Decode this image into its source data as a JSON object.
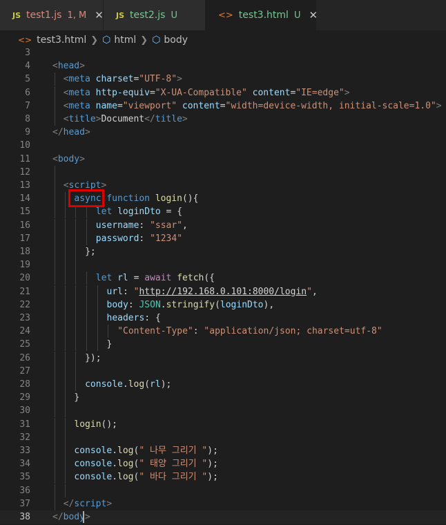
{
  "tabs": [
    {
      "icon": "JS",
      "name": "test1.js",
      "status": "1, M",
      "close": "✕"
    },
    {
      "icon": "JS",
      "name": "test2.js",
      "status": "U",
      "close": ""
    },
    {
      "icon": "<>",
      "name": "test3.html",
      "status": "U",
      "close": "✕"
    }
  ],
  "breadcrumb": {
    "file": "test3.html",
    "items": [
      "html",
      "body"
    ]
  },
  "colors": {
    "modified": "#e0867a",
    "untracked": "#73c991",
    "annotation": "#e00000"
  },
  "editor": {
    "lines": [
      {
        "n": "3",
        "indent": 0,
        "tokens": []
      },
      {
        "n": "4",
        "indent": 0,
        "tokens": [
          [
            "br",
            "<"
          ],
          [
            "tag",
            "head"
          ],
          [
            "br",
            ">"
          ]
        ]
      },
      {
        "n": "5",
        "indent": 1,
        "tokens": [
          [
            "br",
            "<"
          ],
          [
            "tag",
            "meta"
          ],
          [
            "txt",
            " "
          ],
          [
            "attr",
            "charset"
          ],
          [
            "txt",
            "="
          ],
          [
            "str",
            "\"UTF-8\""
          ],
          [
            "br",
            ">"
          ]
        ]
      },
      {
        "n": "6",
        "indent": 1,
        "tokens": [
          [
            "br",
            "<"
          ],
          [
            "tag",
            "meta"
          ],
          [
            "txt",
            " "
          ],
          [
            "attr",
            "http-equiv"
          ],
          [
            "txt",
            "="
          ],
          [
            "str",
            "\"X-UA-Compatible\""
          ],
          [
            "txt",
            " "
          ],
          [
            "attr",
            "content"
          ],
          [
            "txt",
            "="
          ],
          [
            "str",
            "\"IE=edge\""
          ],
          [
            "br",
            ">"
          ]
        ]
      },
      {
        "n": "7",
        "indent": 1,
        "tokens": [
          [
            "br",
            "<"
          ],
          [
            "tag",
            "meta"
          ],
          [
            "txt",
            " "
          ],
          [
            "attr",
            "name"
          ],
          [
            "txt",
            "="
          ],
          [
            "str",
            "\"viewport\""
          ],
          [
            "txt",
            " "
          ],
          [
            "attr",
            "content"
          ],
          [
            "txt",
            "="
          ],
          [
            "str",
            "\"width=device-width, initial-scale=1.0\""
          ],
          [
            "br",
            ">"
          ]
        ]
      },
      {
        "n": "8",
        "indent": 1,
        "tokens": [
          [
            "br",
            "<"
          ],
          [
            "tag",
            "title"
          ],
          [
            "br",
            ">"
          ],
          [
            "txt",
            "Document"
          ],
          [
            "br",
            "</"
          ],
          [
            "tag",
            "title"
          ],
          [
            "br",
            ">"
          ]
        ]
      },
      {
        "n": "9",
        "indent": 0,
        "tokens": [
          [
            "br",
            "</"
          ],
          [
            "tag",
            "head"
          ],
          [
            "br",
            ">"
          ]
        ]
      },
      {
        "n": "10",
        "indent": 0,
        "tokens": []
      },
      {
        "n": "11",
        "indent": 0,
        "tokens": [
          [
            "br",
            "<"
          ],
          [
            "tag",
            "body"
          ],
          [
            "br",
            ">"
          ]
        ]
      },
      {
        "n": "12",
        "indent": 1,
        "tokens": []
      },
      {
        "n": "13",
        "indent": 1,
        "tokens": [
          [
            "br",
            "<"
          ],
          [
            "tag",
            "script"
          ],
          [
            "br",
            ">"
          ]
        ]
      },
      {
        "n": "14",
        "indent": 2,
        "tokens": [
          [
            "kw",
            "async"
          ],
          [
            "txt",
            " "
          ],
          [
            "kw",
            "function"
          ],
          [
            "txt",
            " "
          ],
          [
            "fn",
            "login"
          ],
          [
            "txt",
            "(){"
          ]
        ]
      },
      {
        "n": "15",
        "indent": 4,
        "tokens": [
          [
            "kw",
            "let"
          ],
          [
            "txt",
            " "
          ],
          [
            "var",
            "loginDto"
          ],
          [
            "txt",
            " = {"
          ]
        ]
      },
      {
        "n": "16",
        "indent": 4,
        "tokens": [
          [
            "var",
            "username"
          ],
          [
            "txt",
            ": "
          ],
          [
            "str",
            "\"ssar\""
          ],
          [
            "txt",
            ","
          ]
        ]
      },
      {
        "n": "17",
        "indent": 4,
        "tokens": [
          [
            "var",
            "password"
          ],
          [
            "txt",
            ": "
          ],
          [
            "str",
            "\"1234\""
          ]
        ]
      },
      {
        "n": "18",
        "indent": 3,
        "tokens": [
          [
            "txt",
            "};"
          ]
        ]
      },
      {
        "n": "19",
        "indent": 3,
        "tokens": []
      },
      {
        "n": "20",
        "indent": 4,
        "tokens": [
          [
            "kw",
            "let"
          ],
          [
            "txt",
            " "
          ],
          [
            "var",
            "rl"
          ],
          [
            "txt",
            " = "
          ],
          [
            "ctl",
            "await"
          ],
          [
            "txt",
            " "
          ],
          [
            "fn",
            "fetch"
          ],
          [
            "txt",
            "({"
          ]
        ]
      },
      {
        "n": "21",
        "indent": 5,
        "tokens": [
          [
            "var",
            "url"
          ],
          [
            "txt",
            ": "
          ],
          [
            "str",
            "\""
          ],
          [
            "url",
            "http://192.168.0.101:8000/login"
          ],
          [
            "str",
            "\""
          ],
          [
            "txt",
            ","
          ]
        ]
      },
      {
        "n": "22",
        "indent": 5,
        "tokens": [
          [
            "var",
            "body"
          ],
          [
            "txt",
            ": "
          ],
          [
            "cls",
            "JSON"
          ],
          [
            "txt",
            "."
          ],
          [
            "fn",
            "stringify"
          ],
          [
            "txt",
            "("
          ],
          [
            "var",
            "loginDto"
          ],
          [
            "txt",
            "),"
          ]
        ]
      },
      {
        "n": "23",
        "indent": 5,
        "tokens": [
          [
            "var",
            "headers"
          ],
          [
            "txt",
            ": {"
          ]
        ]
      },
      {
        "n": "24",
        "indent": 6,
        "tokens": [
          [
            "str",
            "\"Content-Type\""
          ],
          [
            "txt",
            ": "
          ],
          [
            "str",
            "\"application/json; charset=utf-8\""
          ]
        ]
      },
      {
        "n": "25",
        "indent": 5,
        "tokens": [
          [
            "txt",
            "}"
          ]
        ]
      },
      {
        "n": "26",
        "indent": 3,
        "tokens": [
          [
            "txt",
            "});"
          ]
        ]
      },
      {
        "n": "27",
        "indent": 3,
        "tokens": []
      },
      {
        "n": "28",
        "indent": 3,
        "tokens": [
          [
            "var",
            "console"
          ],
          [
            "txt",
            "."
          ],
          [
            "fn",
            "log"
          ],
          [
            "txt",
            "("
          ],
          [
            "var",
            "rl"
          ],
          [
            "txt",
            ");"
          ]
        ]
      },
      {
        "n": "29",
        "indent": 2,
        "tokens": [
          [
            "txt",
            "}"
          ]
        ]
      },
      {
        "n": "30",
        "indent": 2,
        "tokens": []
      },
      {
        "n": "31",
        "indent": 2,
        "tokens": [
          [
            "fn",
            "login"
          ],
          [
            "txt",
            "();"
          ]
        ]
      },
      {
        "n": "32",
        "indent": 2,
        "tokens": []
      },
      {
        "n": "33",
        "indent": 2,
        "tokens": [
          [
            "var",
            "console"
          ],
          [
            "txt",
            "."
          ],
          [
            "fn",
            "log"
          ],
          [
            "txt",
            "("
          ],
          [
            "str",
            "\" 나무 그리기 \""
          ],
          [
            "txt",
            ");"
          ]
        ]
      },
      {
        "n": "34",
        "indent": 2,
        "tokens": [
          [
            "var",
            "console"
          ],
          [
            "txt",
            "."
          ],
          [
            "fn",
            "log"
          ],
          [
            "txt",
            "("
          ],
          [
            "str",
            "\" 태양 그리기 \""
          ],
          [
            "txt",
            ");"
          ]
        ]
      },
      {
        "n": "35",
        "indent": 2,
        "tokens": [
          [
            "var",
            "console"
          ],
          [
            "txt",
            "."
          ],
          [
            "fn",
            "log"
          ],
          [
            "txt",
            "("
          ],
          [
            "str",
            "\" 바다 그리기 \""
          ],
          [
            "txt",
            ");"
          ]
        ]
      },
      {
        "n": "36",
        "indent": 2,
        "tokens": []
      },
      {
        "n": "37",
        "indent": 1,
        "tokens": [
          [
            "br",
            "</"
          ],
          [
            "tag",
            "script"
          ],
          [
            "br",
            ">"
          ]
        ]
      },
      {
        "n": "38",
        "indent": 0,
        "tokens": [
          [
            "br",
            "</"
          ],
          [
            "tag",
            "body"
          ],
          [
            "br",
            ">"
          ]
        ]
      }
    ]
  }
}
